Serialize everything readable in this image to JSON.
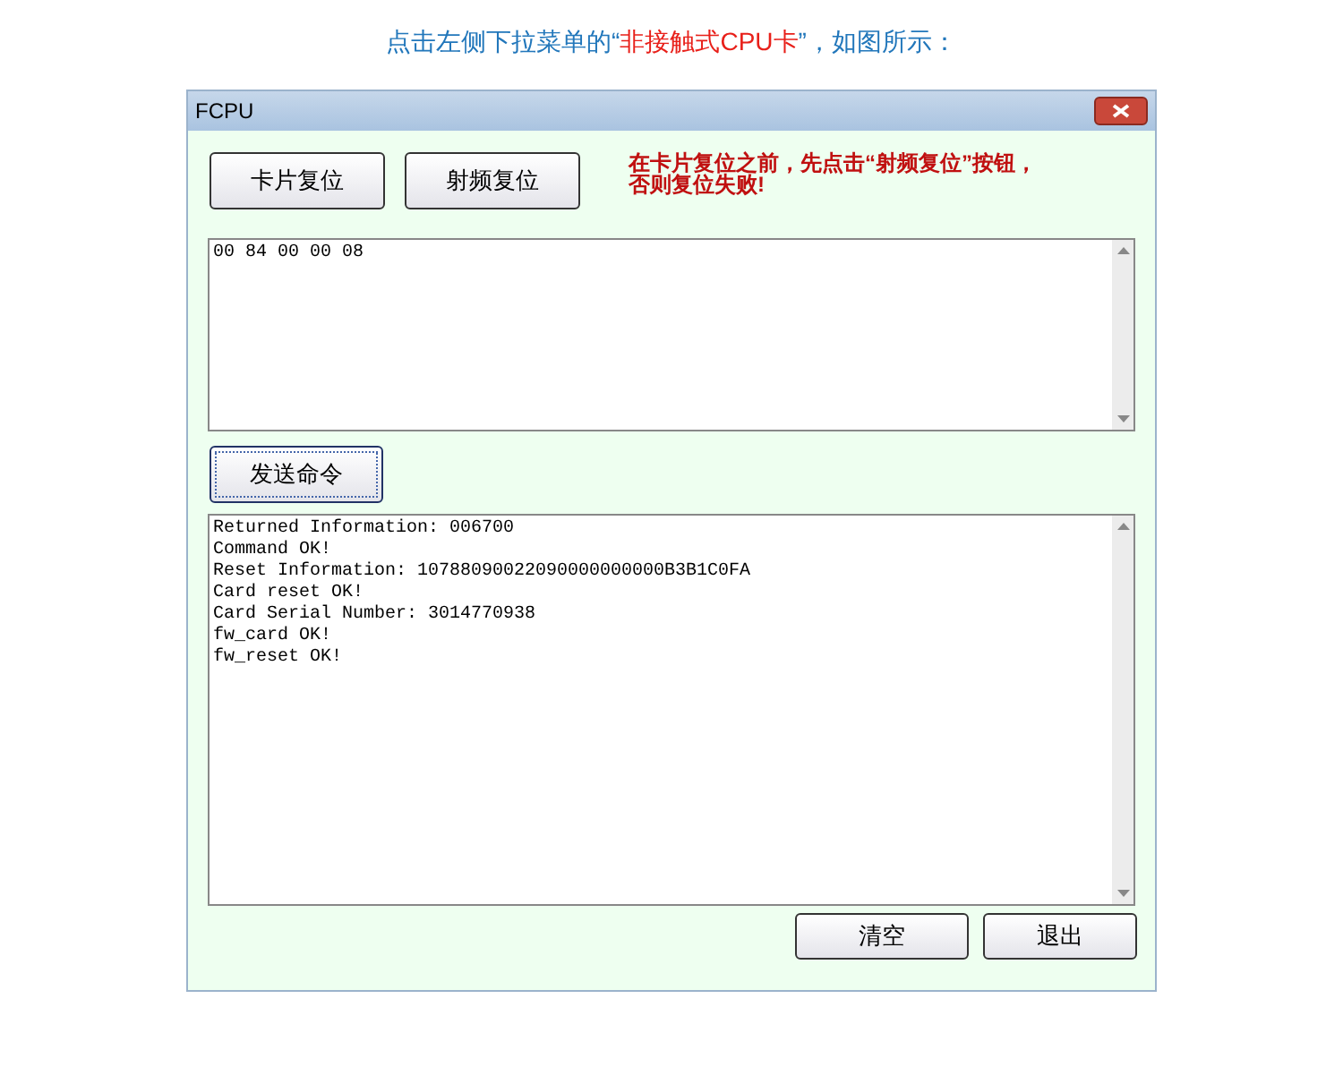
{
  "caption": [
    {
      "text": "点击左侧下拉菜单的“",
      "highlight": false
    },
    {
      "text": "非接触式CPU卡",
      "highlight": true
    },
    {
      "text": "”，如图所示：",
      "highlight": false
    }
  ],
  "window": {
    "title": "FCPU"
  },
  "top_buttons": [
    {
      "label": "卡片复位"
    },
    {
      "label": "射频复位"
    }
  ],
  "warning": [
    "在卡片复位之前，先点击“射频复位”按钮，",
    "否则复位失败!"
  ],
  "command_input": {
    "value": "00 84 00 00 08"
  },
  "send_button": {
    "label": "发送命令",
    "focused": true
  },
  "output_lines": [
    "Returned Information: 006700",
    "Command OK!",
    "Reset Information: 10788090022090000000000B3B1C0FA",
    "Card reset OK!",
    "Card Serial Number: 3014770938",
    "fw_card OK!",
    "fw_reset OK!"
  ],
  "bottom_buttons": [
    {
      "label": "清空"
    },
    {
      "label": "退出"
    }
  ]
}
